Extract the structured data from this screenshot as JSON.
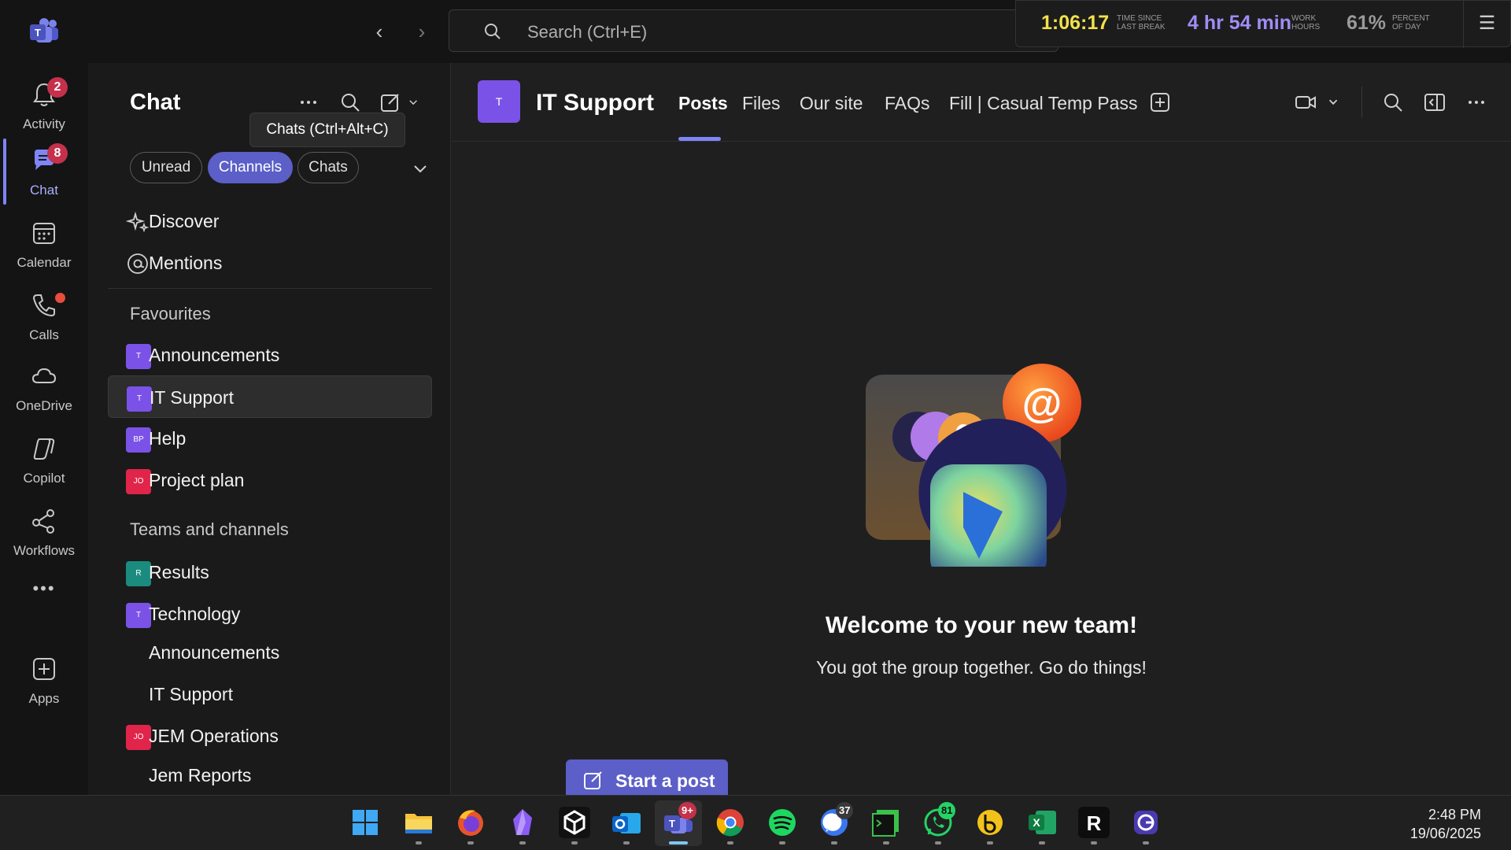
{
  "topbar": {
    "search_placeholder": "Search (Ctrl+E)",
    "timer": {
      "time_since_break": "1:06:17",
      "time_since_break_label_1": "TIME SINCE",
      "time_since_break_label_2": "LAST BREAK",
      "work_hours": "4 hr 54 min",
      "work_hours_label_1": "WORK",
      "work_hours_label_2": "HOURS",
      "percent_of_day": "61%",
      "percent_label_1": "PERCENT",
      "percent_label_2": "OF DAY"
    }
  },
  "rail": {
    "items": [
      {
        "label": "Activity",
        "icon": "bell-icon",
        "badge": "2"
      },
      {
        "label": "Chat",
        "icon": "chat-icon",
        "badge": "8"
      },
      {
        "label": "Calendar",
        "icon": "calendar-icon"
      },
      {
        "label": "Calls",
        "icon": "phone-icon"
      },
      {
        "label": "OneDrive",
        "icon": "cloud-icon"
      },
      {
        "label": "Copilot",
        "icon": "copilot-icon"
      },
      {
        "label": "Workflows",
        "icon": "workflows-icon"
      },
      {
        "label": "Apps",
        "icon": "add-app-icon"
      }
    ],
    "more": "•••"
  },
  "panel": {
    "title": "Chat",
    "tooltip": "Chats (Ctrl+Alt+C)",
    "filters": [
      "Unread",
      "Channels",
      "Chats"
    ],
    "discover": "Discover",
    "mentions": "Mentions",
    "favourites_header": "Favourites",
    "favourites": [
      {
        "label": "Announcements",
        "avatar": "T",
        "color": "#7b52e8"
      },
      {
        "label": "IT Support",
        "avatar": "T",
        "color": "#7b52e8"
      },
      {
        "label": "Help",
        "avatar": "BP",
        "color": "#7b52e8"
      },
      {
        "label": "Project plan",
        "avatar": "JO",
        "color": "#e0244a"
      }
    ],
    "teams_header": "Teams and channels",
    "teams": [
      {
        "label": "Results",
        "avatar": "R",
        "color": "#1b8b7f"
      },
      {
        "label": "Technology",
        "avatar": "T",
        "color": "#7b52e8"
      },
      {
        "label": "Announcements"
      },
      {
        "label": "IT Support"
      },
      {
        "label": "JEM Operations",
        "avatar": "JO",
        "color": "#e0244a"
      },
      {
        "label": "Jem Reports"
      }
    ]
  },
  "main": {
    "team_avatar": "T",
    "team_name": "IT Support",
    "tabs": [
      "Posts",
      "Files",
      "Our site",
      "FAQs",
      "Fill | Casual Temp Pass"
    ],
    "welcome_title": "Welcome to your new team!",
    "welcome_sub": "You got the group together. Go do things!",
    "start_post": "Start a post"
  },
  "taskbar": {
    "apps": [
      {
        "name": "windows-start-icon"
      },
      {
        "name": "file-explorer-icon"
      },
      {
        "name": "firefox-icon"
      },
      {
        "name": "obsidian-icon"
      },
      {
        "name": "unity-icon"
      },
      {
        "name": "outlook-icon"
      },
      {
        "name": "teams-icon",
        "badge": "9+"
      },
      {
        "name": "chrome-icon"
      },
      {
        "name": "spotify-icon"
      },
      {
        "name": "signal-icon",
        "badge": "37"
      },
      {
        "name": "terminal-icon"
      },
      {
        "name": "whatsapp-icon",
        "badge": "81"
      },
      {
        "name": "bitwarden-icon"
      },
      {
        "name": "excel-icon"
      },
      {
        "name": "r-icon"
      },
      {
        "name": "g-app-icon"
      }
    ],
    "time": "2:48 PM",
    "date": "19/06/2025"
  }
}
